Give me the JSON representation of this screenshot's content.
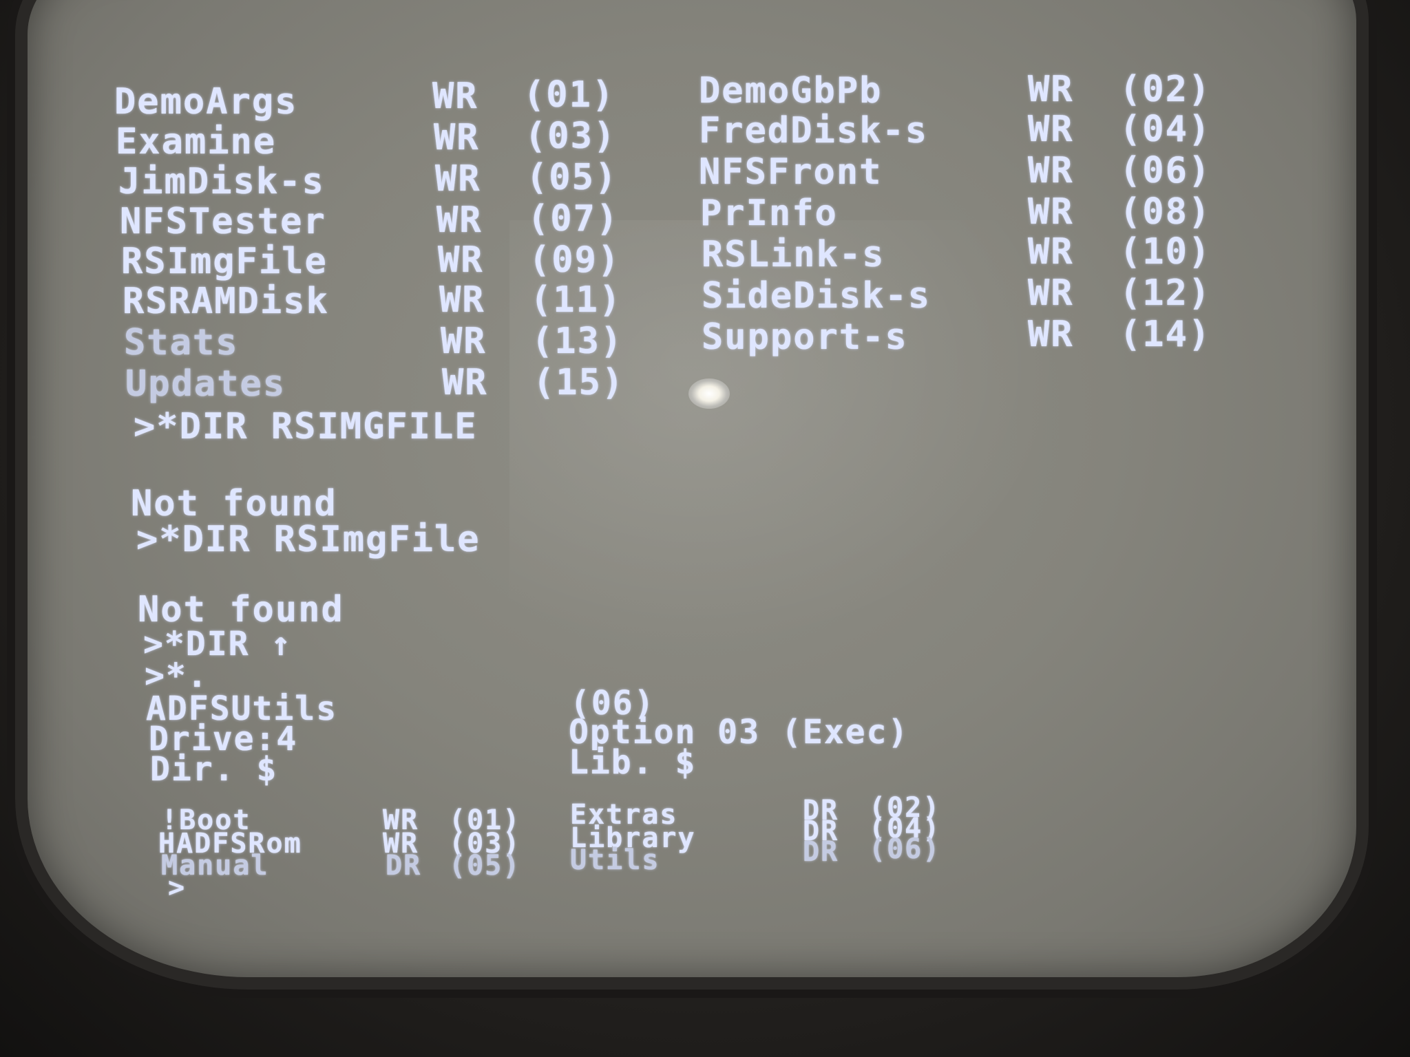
{
  "listing": {
    "rows": [
      {
        "name_left": "DemoArgs",
        "access_left": "WR",
        "seq_left": "(01)",
        "name_right": "DemoGbPb",
        "access_right": "WR",
        "seq_right": "(02)"
      },
      {
        "name_left": "Examine",
        "access_left": "WR",
        "seq_left": "(03)",
        "name_right": "FredDisk-s",
        "access_right": "WR",
        "seq_right": "(04)"
      },
      {
        "name_left": "JimDisk-s",
        "access_left": "WR",
        "seq_left": "(05)",
        "name_right": "NFSFront",
        "access_right": "WR",
        "seq_right": "(06)"
      },
      {
        "name_left": "NFSTester",
        "access_left": "WR",
        "seq_left": "(07)",
        "name_right": "PrInfo",
        "access_right": "WR",
        "seq_right": "(08)"
      },
      {
        "name_left": "RSImgFile",
        "access_left": "WR",
        "seq_left": "(09)",
        "name_right": "RSLink-s",
        "access_right": "WR",
        "seq_right": "(10)"
      },
      {
        "name_left": "RSRAMDisk",
        "access_left": "WR",
        "seq_left": "(11)",
        "name_right": "SideDisk-s",
        "access_right": "WR",
        "seq_right": "(12)"
      },
      {
        "name_left": "Stats",
        "access_left": "WR",
        "seq_left": "(13)",
        "name_right": "Support-s",
        "access_right": "WR",
        "seq_right": "(14)"
      },
      {
        "name_left": "Updates",
        "access_left": "WR",
        "seq_left": "(15)",
        "name_right": "",
        "access_right": "",
        "seq_right": ""
      }
    ]
  },
  "session": {
    "cmd1": ">*DIR RSIMGFILE",
    "msg1": "Not found",
    "cmd2": ">*DIR RSImgFile",
    "msg2": "Not found",
    "cmd3": ">*DIR ↑",
    "cmd4": ">*."
  },
  "catalog": {
    "disc_title": "ADFSUtils",
    "cycle": "(06)",
    "drive": "Drive:4",
    "option": "Option 03 (Exec)",
    "dir": "Dir. $",
    "lib": "Lib. $",
    "entries": [
      {
        "name_left": "!Boot",
        "access_left": "WR",
        "seq_left": "(01)",
        "name_right": "Extras",
        "access_right": "DR",
        "seq_right": "(02)"
      },
      {
        "name_left": "HADFSRom",
        "access_left": "WR",
        "seq_left": "(03)",
        "name_right": "Library",
        "access_right": "DR",
        "seq_right": "(04)"
      },
      {
        "name_left": "Manual",
        "access_left": "DR",
        "seq_left": "(05)",
        "name_right": "Utils",
        "access_right": "DR",
        "seq_right": "(06)"
      }
    ],
    "prompt": ">"
  },
  "colors": {
    "phosphor_text": "#dfe6ff",
    "screen": "#85847c"
  }
}
